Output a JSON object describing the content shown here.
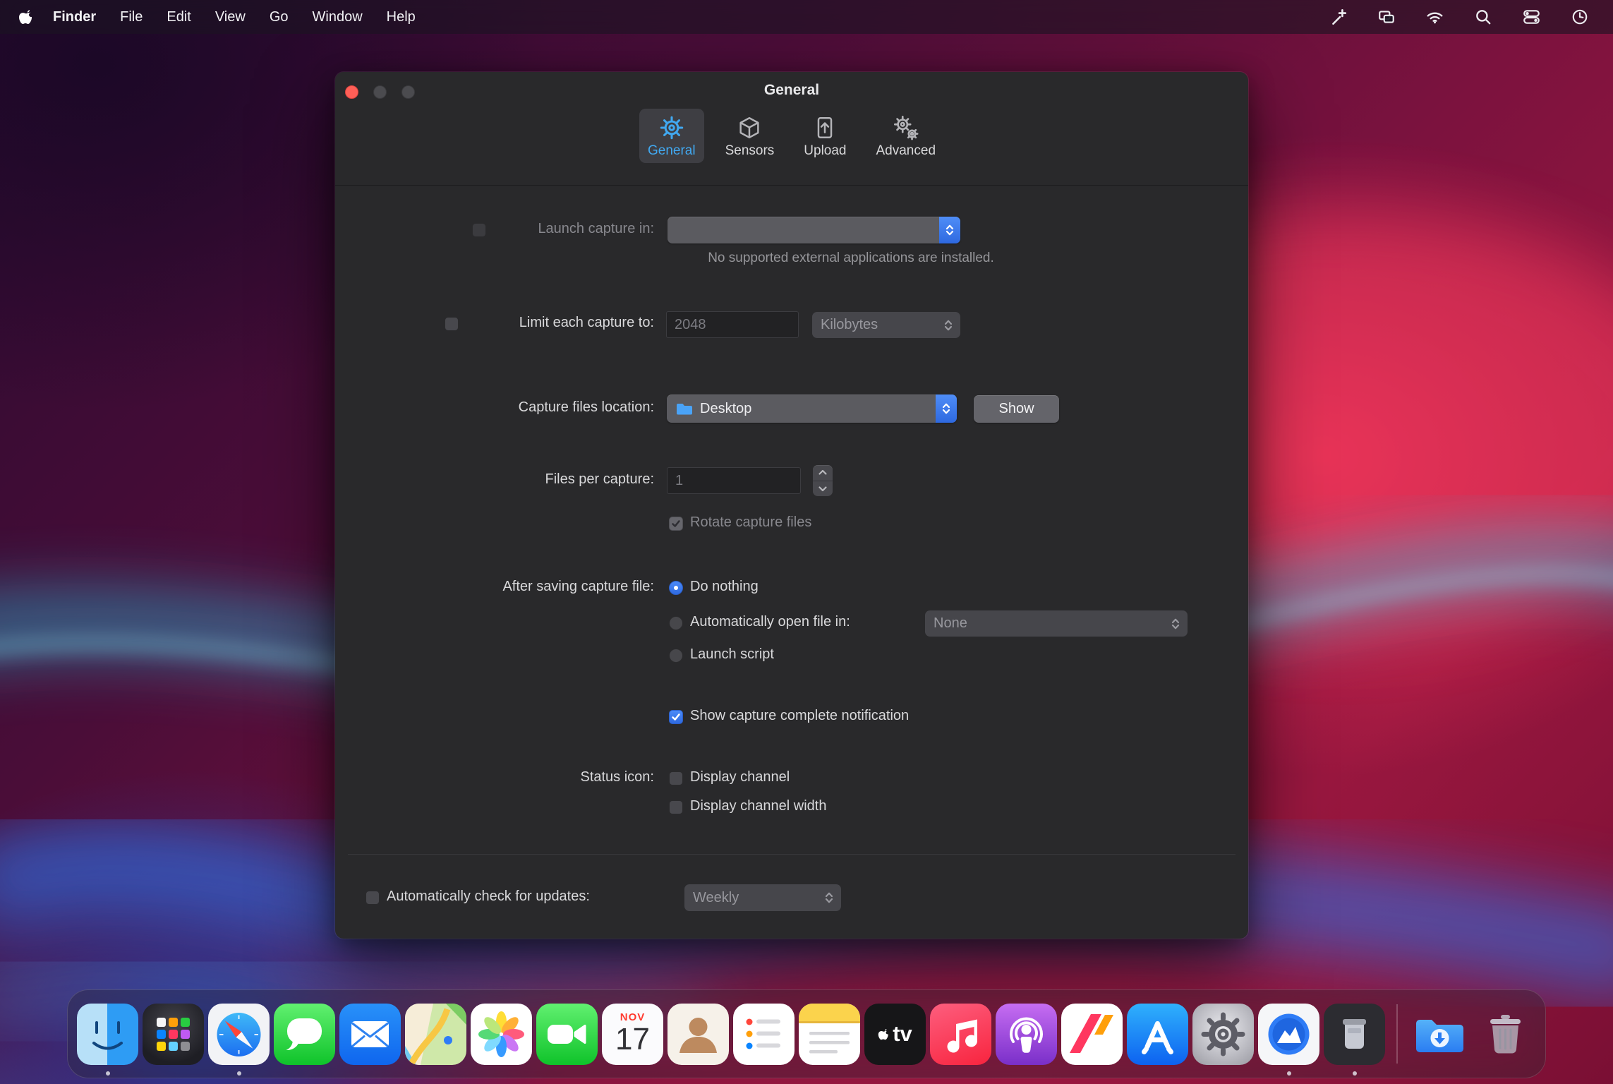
{
  "menubar": {
    "app_name": "Finder",
    "menus": [
      "File",
      "Edit",
      "View",
      "Go",
      "Window",
      "Help"
    ],
    "status_icons": [
      "wand-icon",
      "windows-icon",
      "wifi-icon",
      "search-icon",
      "control-center-icon",
      "clock-icon"
    ]
  },
  "window": {
    "title": "General",
    "toolbar": {
      "tabs": [
        {
          "label": "General",
          "icon": "gear-icon",
          "selected": true
        },
        {
          "label": "Sensors",
          "icon": "cube-icon",
          "selected": false
        },
        {
          "label": "Upload",
          "icon": "upload-icon",
          "selected": false
        },
        {
          "label": "Advanced",
          "icon": "gears-icon",
          "selected": false
        }
      ]
    },
    "launch_capture": {
      "label": "Launch capture in:",
      "checkbox_checked": false,
      "popup_value": "",
      "caption": "No supported external applications are installed."
    },
    "limit_capture": {
      "label": "Limit each capture to:",
      "checkbox_checked": false,
      "size_value": "2048",
      "unit_value": "Kilobytes"
    },
    "location": {
      "label": "Capture files location:",
      "popup_value": "Desktop",
      "show_button": "Show"
    },
    "files_per_capture": {
      "label": "Files per capture:",
      "value": "1",
      "rotate_checked": true,
      "rotate_label": "Rotate capture files"
    },
    "after_saving": {
      "label": "After saving capture file:",
      "option_do_nothing": "Do nothing",
      "option_open_in": "Automatically open file in:",
      "open_in_value": "None",
      "option_launch_script": "Launch script",
      "selected_option": "Do nothing"
    },
    "notification": {
      "checked": true,
      "label": "Show capture complete notification"
    },
    "status_icon": {
      "label": "Status icon:",
      "option_channel": "Display channel",
      "option_channel_width": "Display channel width"
    },
    "updates": {
      "checked": false,
      "label": "Automatically check for updates:",
      "frequency_value": "Weekly"
    }
  },
  "dock": {
    "items": [
      "finder",
      "launchpad",
      "safari",
      "messages",
      "mail",
      "maps",
      "photos",
      "facetime",
      "calendar",
      "contacts",
      "reminders",
      "notes",
      "tv",
      "music",
      "podcasts",
      "news",
      "app-store",
      "system-preferences",
      "monitor-app",
      "capture-app",
      "separator",
      "downloads",
      "trash"
    ],
    "running": [
      "finder",
      "safari",
      "monitor-app",
      "capture-app"
    ],
    "calendar": {
      "month": "NOV",
      "day": "17"
    },
    "tv_label": "tv"
  },
  "colors": {
    "accent_blue": "#3478f6",
    "toolbar_selected_icon": "#41a8f0",
    "window_bg": "#29292b",
    "menubar_text": "#f2f2f5",
    "close_button": "#fe5f57"
  }
}
